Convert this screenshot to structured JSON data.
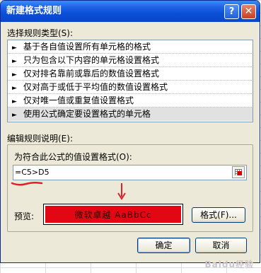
{
  "dialog": {
    "title": "新建格式规则",
    "help_button": "?",
    "close_button": "✕"
  },
  "rule_type": {
    "label": "选择规则类型(S):",
    "items": [
      {
        "label": "基于各自值设置所有单元格的格式"
      },
      {
        "label": "只为包含以下内容的单元格设置格式"
      },
      {
        "label": "仅对排名靠前或靠后的数值设置格式"
      },
      {
        "label": "仅对高于或低于平均值的数值设置格式"
      },
      {
        "label": "仅对唯一值或重复值设置格式"
      },
      {
        "label": "使用公式确定要设置格式的单元格",
        "selected": true
      }
    ]
  },
  "rule_description": {
    "label": "编辑规则说明(E):",
    "formula_label": "为符合此公式的值设置格式(O):",
    "formula_value": "=C5>D5",
    "preview_label": "预览:",
    "preview_text": "微软卓越  AaBbCc",
    "preview_bg": "#e30613",
    "format_button": "格式(F)..."
  },
  "buttons": {
    "ok": "确定",
    "cancel": "取消"
  },
  "watermark": "Baidu经验",
  "colors": {
    "titlebar": "#0a4fd8",
    "dialog_bg": "#ece9d8",
    "annotation": "#e0202a"
  }
}
